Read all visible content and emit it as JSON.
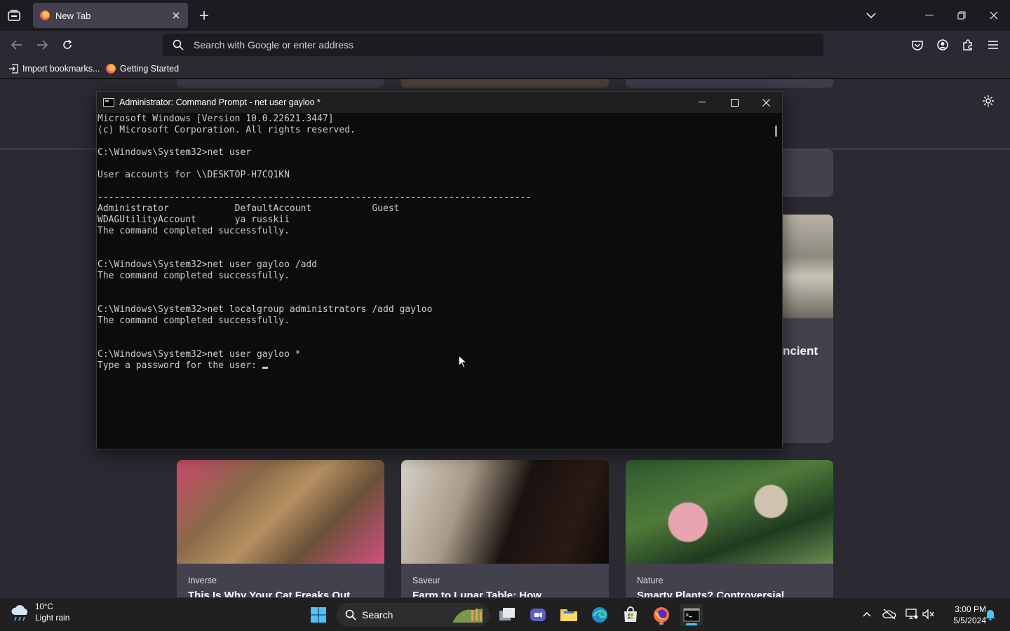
{
  "browser": {
    "tab_title": "New Tab",
    "url_placeholder": "Search with Google or enter address",
    "bookmarks": [
      "Import bookmarks...",
      "Getting Started"
    ]
  },
  "newtab": {
    "side_headline_partial": "ncient",
    "cards": [
      {
        "source": "Inverse",
        "headline": "This Is Why Your Cat Freaks Out",
        "photo": "tabby-cat"
      },
      {
        "source": "Saveur",
        "headline": "Farm to Lunar Table: How",
        "photo": "man-eating"
      },
      {
        "source": "Nature",
        "headline": "Smarty Plants? Controversial",
        "photo": "plants"
      }
    ]
  },
  "cmd": {
    "title": "Administrator: Command Prompt - net  user gayloo *",
    "lines": [
      "Microsoft Windows [Version 10.0.22621.3447]",
      "(c) Microsoft Corporation. All rights reserved.",
      "",
      "C:\\Windows\\System32>net user",
      "",
      "User accounts for \\\\DESKTOP-H7CQ1KN",
      "",
      "-------------------------------------------------------------------------------",
      "Administrator            DefaultAccount           Guest",
      "WDAGUtilityAccount       ya russkii",
      "The command completed successfully.",
      "",
      "",
      "C:\\Windows\\System32>net user gayloo /add",
      "The command completed successfully.",
      "",
      "",
      "C:\\Windows\\System32>net localgroup administrators /add gayloo",
      "The command completed successfully.",
      "",
      "",
      "C:\\Windows\\System32>net user gayloo *",
      "Type a password for the user: "
    ]
  },
  "taskbar": {
    "weather_temp": "10°C",
    "weather_cond": "Light rain",
    "search_label": "Search",
    "time": "3:00 PM",
    "date": "5/5/2024"
  },
  "colors": {
    "accent": "#4cc2ff",
    "firefox_orange": "#ff7139",
    "cmd_text": "#cccccc"
  }
}
